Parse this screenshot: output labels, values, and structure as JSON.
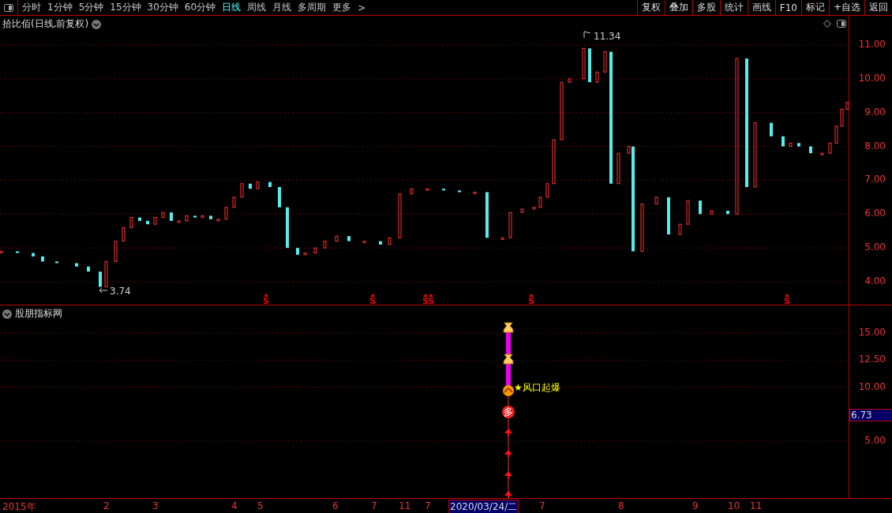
{
  "toolbar": {
    "periods": [
      {
        "label": "分时",
        "selected": false
      },
      {
        "label": "1分钟",
        "selected": false
      },
      {
        "label": "5分钟",
        "selected": false
      },
      {
        "label": "15分钟",
        "selected": false
      },
      {
        "label": "30分钟",
        "selected": false
      },
      {
        "label": "60分钟",
        "selected": false
      },
      {
        "label": "日线",
        "selected": true
      },
      {
        "label": "周线",
        "selected": false
      },
      {
        "label": "月线",
        "selected": false
      },
      {
        "label": "多周期",
        "selected": false
      },
      {
        "label": "更多",
        "selected": false
      }
    ],
    "more_chevron": ">",
    "buttons": [
      "复权",
      "叠加",
      "多股",
      "统计",
      "画线",
      "F10",
      "标记",
      "+自选",
      "返回"
    ]
  },
  "price_panel": {
    "title": "拾比佰(日线,前复权)",
    "y_axis": [
      "11.00",
      "10.00",
      "9.00",
      "8.00",
      "7.00",
      "6.00",
      "5.00",
      "4.00"
    ],
    "high_label": "11.34",
    "low_label": "3.74",
    "signal_marks": [
      "S",
      "S",
      "S",
      "S",
      "S",
      "S"
    ]
  },
  "indicator_panel": {
    "title": "股朋指标网",
    "y_axis": [
      "15.00",
      "12.50",
      "10.00",
      "5.00"
    ],
    "current_value": "6.73",
    "signal_badge": "多",
    "annotation": "★风口起爆"
  },
  "x_axis": {
    "labels": [
      "2015年",
      "2",
      "3",
      "4",
      "5",
      "6",
      "7",
      "11",
      "7",
      "7",
      "8",
      "9",
      "10",
      "11"
    ],
    "cursor_date": "2020/03/24/二"
  }
}
